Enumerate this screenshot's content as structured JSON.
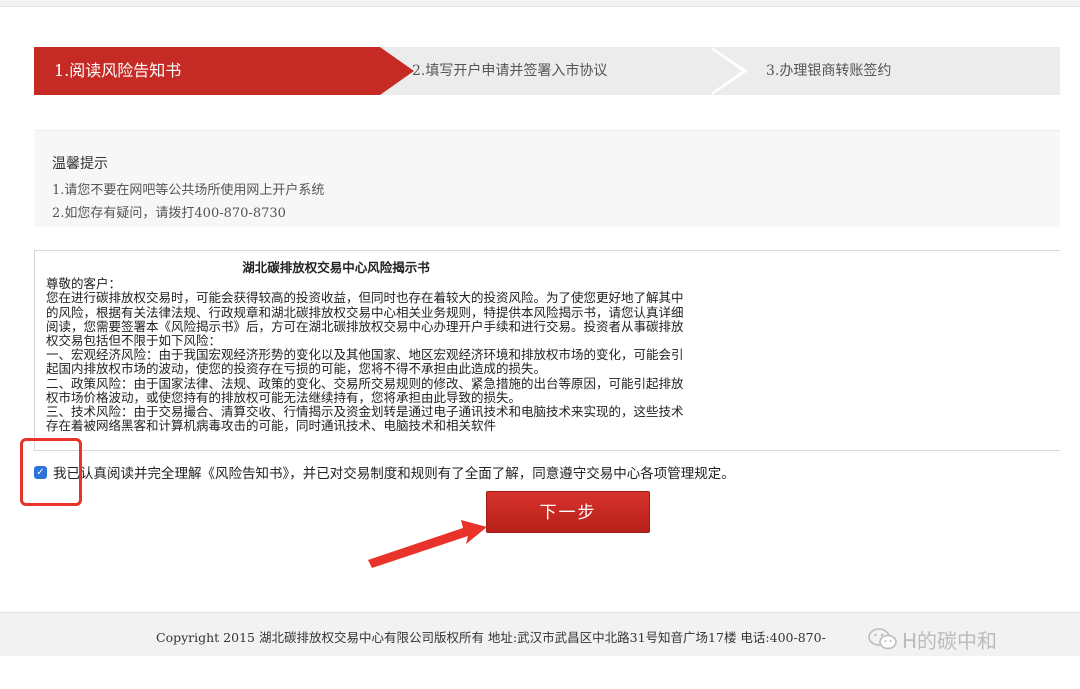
{
  "steps": [
    {
      "label": "1.阅读风险告知书",
      "active": true
    },
    {
      "label": "2.填写开户申请并签署入市协议",
      "active": false
    },
    {
      "label": "3.办理银商转账签约",
      "active": false
    }
  ],
  "notice": {
    "title": "温馨提示",
    "lines": [
      "1.请您不要在网吧等公共场所使用网上开户系统",
      "2.如您存有疑问，请拨打400-870-8730"
    ]
  },
  "risk": {
    "title": "湖北碳排放权交易中心风险揭示书",
    "paragraphs": [
      "尊敬的客户：",
      "您在进行碳排放权交易时，可能会获得较高的投资收益，但同时也存在着较大的投资风险。为了使您更好地了解其中的风险，根据有关法律法规、行政规章和湖北碳排放权交易中心相关业务规则，特提供本风险揭示书，请您认真详细阅读，您需要签署本《风险揭示书》后，方可在湖北碳排放权交易中心办理开户手续和进行交易。投资者从事碳排放权交易包括但不限于如下风险：",
      "一、宏观经济风险：由于我国宏观经济形势的变化以及其他国家、地区宏观经济环境和排放权市场的变化，可能会引起国内排放权市场的波动，使您的投资存在亏损的可能，您将不得不承担由此造成的损失。",
      "二、政策风险：由于国家法律、法规、政策的变化、交易所交易规则的修改、紧急措施的出台等原因，可能引起排放权市场价格波动，或使您持有的排放权可能无法继续持有，您将承担由此导致的损失。",
      "三、技术风险：由于交易撮合、清算交收、行情揭示及资金划转是通过电子通讯技术和电脑技术来实现的，这些技术存在着被网络黑客和计算机病毒攻击的可能，同时通讯技术、电脑技术和相关软件"
    ]
  },
  "agree": {
    "checked": true,
    "text": "我已认真阅读并完全理解《风险告知书》，并已对交易制度和规则有了全面了解，同意遵守交易中心各项管理规定。"
  },
  "next_button": "下一步",
  "footer": {
    "text": "Copyright 2015 湖北碳排放权交易中心有限公司版权所有  地址:武汉市武昌区中北路31号知音广场17楼      电话:400-870-"
  },
  "watermark": {
    "text": "H的碳中和"
  },
  "colors": {
    "accent": "#c62a24",
    "annotation": "#e8322a",
    "checkbox": "#2e73d8"
  }
}
